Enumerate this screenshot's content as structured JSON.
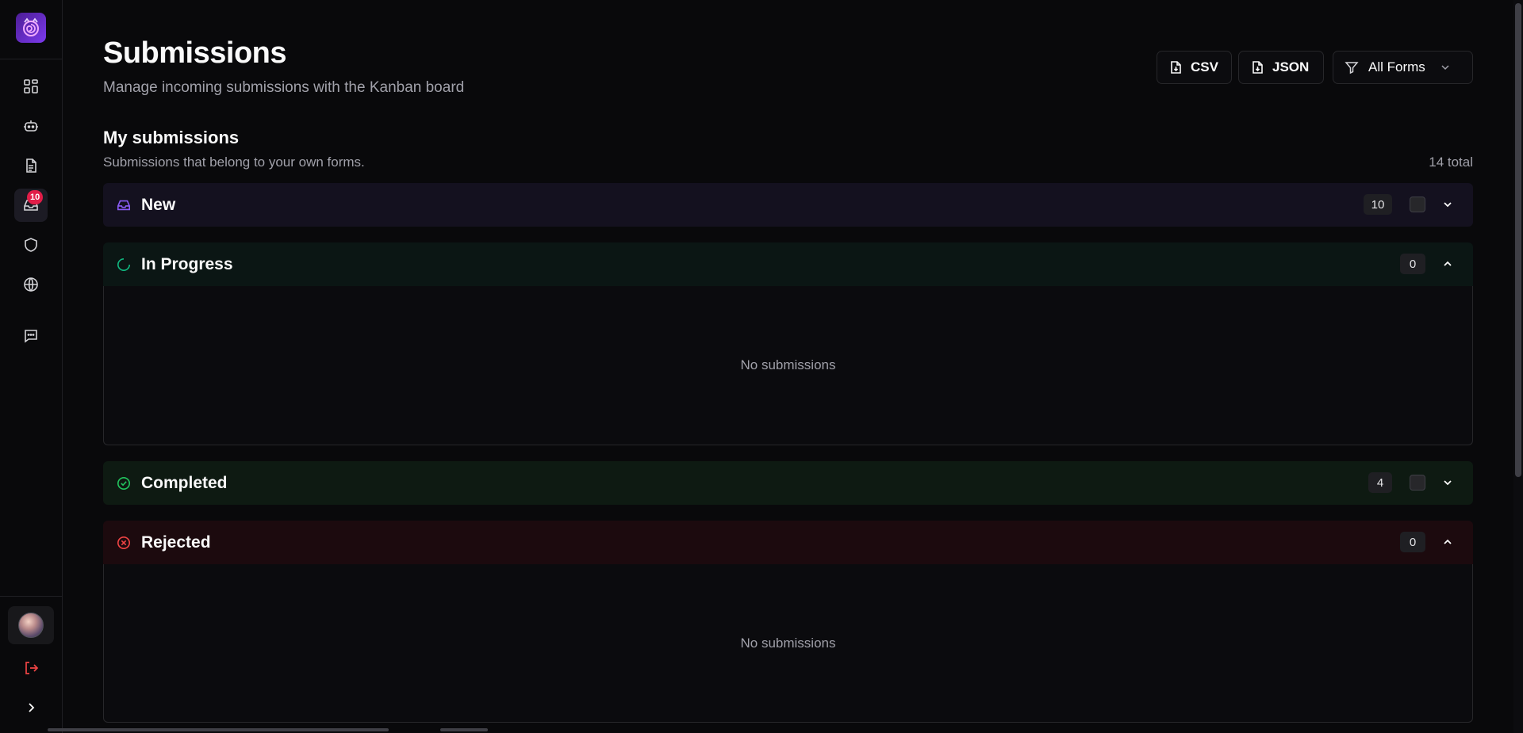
{
  "page": {
    "title": "Submissions",
    "subtitle": "Manage incoming submissions with the Kanban board"
  },
  "toolbar": {
    "csv_label": "CSV",
    "json_label": "JSON",
    "filter_label": "All Forms"
  },
  "sidebar": {
    "items": [
      {
        "icon": "dashboard-icon"
      },
      {
        "icon": "bot-icon"
      },
      {
        "icon": "document-icon"
      },
      {
        "icon": "inbox-icon",
        "badge": "10",
        "active": true
      },
      {
        "icon": "shield-icon"
      },
      {
        "icon": "globe-icon"
      },
      {
        "icon": "chat-icon"
      }
    ],
    "logout_icon": "logout-icon",
    "expand_icon": "chevron-right-icon"
  },
  "section": {
    "title": "My submissions",
    "subtitle": "Submissions that belong to your own forms.",
    "total": "14 total"
  },
  "groups": [
    {
      "label": "New",
      "count": "10",
      "expanded": false,
      "color": "#8b5cf6",
      "bg": "#14111f"
    },
    {
      "label": "In Progress",
      "count": "0",
      "expanded": true,
      "color": "#10b981",
      "bg": "#0b1614",
      "empty_text": "No submissions"
    },
    {
      "label": "Completed",
      "count": "4",
      "expanded": false,
      "color": "#22c55e",
      "bg": "#0e1a12"
    },
    {
      "label": "Rejected",
      "count": "0",
      "expanded": true,
      "color": "#ef4444",
      "bg": "#1c0a0e",
      "empty_text": "No submissions"
    }
  ],
  "colors": {
    "background": "#09090b",
    "badge": "#e11d48",
    "accent": "#8b5cf6"
  }
}
